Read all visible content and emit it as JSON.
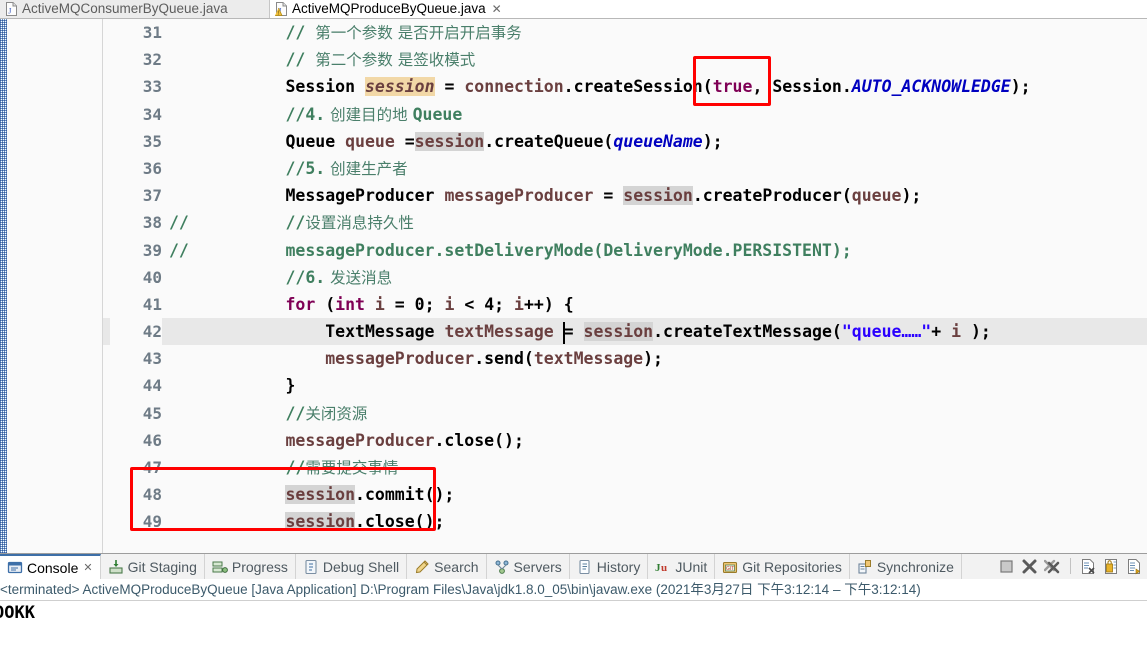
{
  "editor_tabs": [
    {
      "label": "ActiveMQConsumerByQueue.java",
      "icon": "java-file-icon",
      "active": false,
      "close": "✕"
    },
    {
      "label": "ActiveMQProduceByQueue.java",
      "icon": "java-file-warning-icon",
      "active": true,
      "close": "✕"
    }
  ],
  "code_lines": [
    {
      "num": "31",
      "gutter_comment": "",
      "highlight": false,
      "tokens": [
        {
          "t": "        ",
          "c": "plain"
        },
        {
          "t": "// ",
          "c": "cmt"
        },
        {
          "t": "第一个参数 是否开启开启事务",
          "c": "cmtcn"
        }
      ]
    },
    {
      "num": "32",
      "gutter_comment": "",
      "highlight": false,
      "tokens": [
        {
          "t": "        ",
          "c": "plain"
        },
        {
          "t": "// ",
          "c": "cmt"
        },
        {
          "t": "第二个参数 是签收模式",
          "c": "cmtcn"
        }
      ]
    },
    {
      "num": "33",
      "gutter_comment": "",
      "highlight": false,
      "tokens": [
        {
          "t": "        ",
          "c": "plain"
        },
        {
          "t": "Session ",
          "c": "type"
        },
        {
          "t": "session",
          "c": "loc occw"
        },
        {
          "t": " = ",
          "c": "plain"
        },
        {
          "t": "connection",
          "c": "ident"
        },
        {
          "t": ".createSession(",
          "c": "plain"
        },
        {
          "t": "true",
          "c": "kw"
        },
        {
          "t": ", ",
          "c": "plain"
        },
        {
          "t": "Session",
          "c": "type"
        },
        {
          "t": ".",
          "c": "plain"
        },
        {
          "t": "AUTO_ACKNOWLEDGE",
          "c": "fld"
        },
        {
          "t": ");",
          "c": "plain"
        }
      ]
    },
    {
      "num": "34",
      "gutter_comment": "",
      "highlight": false,
      "tokens": [
        {
          "t": "        ",
          "c": "plain"
        },
        {
          "t": "//4.",
          "c": "cmt"
        },
        {
          "t": " 创建目的地 ",
          "c": "cmtcn"
        },
        {
          "t": "Queue",
          "c": "cmt"
        }
      ]
    },
    {
      "num": "35",
      "gutter_comment": "",
      "highlight": false,
      "tokens": [
        {
          "t": "        ",
          "c": "plain"
        },
        {
          "t": "Queue ",
          "c": "type"
        },
        {
          "t": "queue ",
          "c": "ident"
        },
        {
          "t": "=",
          "c": "plain"
        },
        {
          "t": "session",
          "c": "ident occ"
        },
        {
          "t": ".createQueue(",
          "c": "plain"
        },
        {
          "t": "queueName",
          "c": "fld"
        },
        {
          "t": ");",
          "c": "plain"
        }
      ]
    },
    {
      "num": "36",
      "gutter_comment": "",
      "highlight": false,
      "tokens": [
        {
          "t": "        ",
          "c": "plain"
        },
        {
          "t": "//5.",
          "c": "cmt"
        },
        {
          "t": " 创建生产者",
          "c": "cmtcn"
        }
      ]
    },
    {
      "num": "37",
      "gutter_comment": "",
      "highlight": false,
      "tokens": [
        {
          "t": "        ",
          "c": "plain"
        },
        {
          "t": "MessageProducer ",
          "c": "type"
        },
        {
          "t": "messageProducer",
          "c": "ident"
        },
        {
          "t": " = ",
          "c": "plain"
        },
        {
          "t": "session",
          "c": "ident occ"
        },
        {
          "t": ".createProducer(",
          "c": "plain"
        },
        {
          "t": "queue",
          "c": "ident"
        },
        {
          "t": ");",
          "c": "plain"
        }
      ]
    },
    {
      "num": "38",
      "gutter_comment": "//",
      "highlight": false,
      "tokens": [
        {
          "t": "        ",
          "c": "plain"
        },
        {
          "t": "//",
          "c": "cmt"
        },
        {
          "t": "设置消息持久性",
          "c": "cmtcn"
        }
      ]
    },
    {
      "num": "39",
      "gutter_comment": "//",
      "highlight": false,
      "tokens": [
        {
          "t": "        ",
          "c": "plain"
        },
        {
          "t": "messageProducer.setDeliveryMode(DeliveryMode.PERSISTENT);",
          "c": "cmt"
        }
      ]
    },
    {
      "num": "40",
      "gutter_comment": "",
      "highlight": false,
      "tokens": [
        {
          "t": "        ",
          "c": "plain"
        },
        {
          "t": "//6.",
          "c": "cmt"
        },
        {
          "t": " 发送消息",
          "c": "cmtcn"
        }
      ]
    },
    {
      "num": "41",
      "gutter_comment": "",
      "highlight": false,
      "tokens": [
        {
          "t": "        ",
          "c": "plain"
        },
        {
          "t": "for",
          "c": "kw"
        },
        {
          "t": " (",
          "c": "plain"
        },
        {
          "t": "int",
          "c": "kw"
        },
        {
          "t": " ",
          "c": "plain"
        },
        {
          "t": "i",
          "c": "ident"
        },
        {
          "t": " = ",
          "c": "plain"
        },
        {
          "t": "0",
          "c": "plain"
        },
        {
          "t": "; ",
          "c": "plain"
        },
        {
          "t": "i",
          "c": "ident"
        },
        {
          "t": " < ",
          "c": "plain"
        },
        {
          "t": "4",
          "c": "plain"
        },
        {
          "t": "; ",
          "c": "plain"
        },
        {
          "t": "i",
          "c": "ident"
        },
        {
          "t": "++) {",
          "c": "plain"
        }
      ]
    },
    {
      "num": "42",
      "gutter_comment": "",
      "highlight": true,
      "tokens": [
        {
          "t": "            ",
          "c": "plain"
        },
        {
          "t": "TextMessage ",
          "c": "type"
        },
        {
          "t": "textMessage",
          "c": "ident"
        },
        {
          "t": " = ",
          "c": "plain"
        },
        {
          "t": "session",
          "c": "ident occ"
        },
        {
          "t": ".createTextMessage(",
          "c": "plain"
        },
        {
          "t": "\"queue……\"",
          "c": "str"
        },
        {
          "t": "+ ",
          "c": "plain"
        },
        {
          "t": "i",
          "c": "ident"
        },
        {
          "t": " );",
          "c": "plain"
        }
      ]
    },
    {
      "num": "43",
      "gutter_comment": "",
      "highlight": false,
      "tokens": [
        {
          "t": "            ",
          "c": "plain"
        },
        {
          "t": "messageProducer",
          "c": "ident"
        },
        {
          "t": ".send(",
          "c": "plain"
        },
        {
          "t": "textMessage",
          "c": "ident"
        },
        {
          "t": ");",
          "c": "plain"
        }
      ]
    },
    {
      "num": "44",
      "gutter_comment": "",
      "highlight": false,
      "tokens": [
        {
          "t": "        }",
          "c": "plain"
        }
      ]
    },
    {
      "num": "45",
      "gutter_comment": "",
      "highlight": false,
      "tokens": [
        {
          "t": "        ",
          "c": "plain"
        },
        {
          "t": "//",
          "c": "cmt"
        },
        {
          "t": "关闭资源",
          "c": "cmtcn"
        }
      ]
    },
    {
      "num": "46",
      "gutter_comment": "",
      "highlight": false,
      "tokens": [
        {
          "t": "        ",
          "c": "plain"
        },
        {
          "t": "messageProducer",
          "c": "ident"
        },
        {
          "t": ".close();",
          "c": "plain"
        }
      ]
    },
    {
      "num": "47",
      "gutter_comment": "",
      "highlight": false,
      "tokens": [
        {
          "t": "        ",
          "c": "plain"
        },
        {
          "t": "//",
          "c": "cmt"
        },
        {
          "t": "需要提交事情",
          "c": "cmtcn"
        }
      ]
    },
    {
      "num": "48",
      "gutter_comment": "",
      "highlight": false,
      "tokens": [
        {
          "t": "        ",
          "c": "plain"
        },
        {
          "t": "session",
          "c": "ident occ"
        },
        {
          "t": ".commit();",
          "c": "plain"
        }
      ]
    },
    {
      "num": "49",
      "gutter_comment": "",
      "highlight": false,
      "tokens": [
        {
          "t": "        ",
          "c": "plain"
        },
        {
          "t": "session",
          "c": "ident occ"
        },
        {
          "t": ".close();",
          "c": "plain"
        }
      ]
    }
  ],
  "annotations": {
    "box_true_line33": {
      "label": "red-highlight-box-true"
    },
    "box_commit_line47_48": {
      "label": "red-highlight-box-commit"
    },
    "accent_red": "#ff0000",
    "current_line_bg": "#e8e8e8",
    "occurrence_bg": "#d4d4d4",
    "write_occurrence_bg": "#f2d8a7"
  },
  "view_tabs": [
    {
      "label": "Console",
      "icon": "console-icon",
      "active": true,
      "close": "✕"
    },
    {
      "label": "Git Staging",
      "icon": "git-staging-icon",
      "active": false
    },
    {
      "label": "Progress",
      "icon": "progress-icon",
      "active": false
    },
    {
      "label": "Debug Shell",
      "icon": "debug-shell-icon",
      "active": false
    },
    {
      "label": "Search",
      "icon": "search-icon",
      "active": false
    },
    {
      "label": "Servers",
      "icon": "servers-icon",
      "active": false
    },
    {
      "label": "History",
      "icon": "history-icon",
      "active": false
    },
    {
      "label": "JUnit",
      "icon": "junit-icon",
      "active": false
    },
    {
      "label": "Git Repositories",
      "icon": "git-repositories-icon",
      "active": false
    },
    {
      "label": "Synchronize",
      "icon": "synchronize-icon",
      "active": false
    }
  ],
  "view_tools": [
    {
      "name": "terminate-icon"
    },
    {
      "name": "remove-launch-icon"
    },
    {
      "name": "remove-all-launches-icon"
    },
    {
      "name": "open-console-icon"
    },
    {
      "name": "pin-console-icon"
    },
    {
      "name": "display-selected-console-icon"
    }
  ],
  "console": {
    "header": "<terminated> ActiveMQProduceByQueue [Java Application] D:\\Program Files\\Java\\jdk1.8.0_05\\bin\\javaw.exe  (2021年3月27日 下午3:12:14 – 下午3:12:14)",
    "output": "OOKK"
  }
}
